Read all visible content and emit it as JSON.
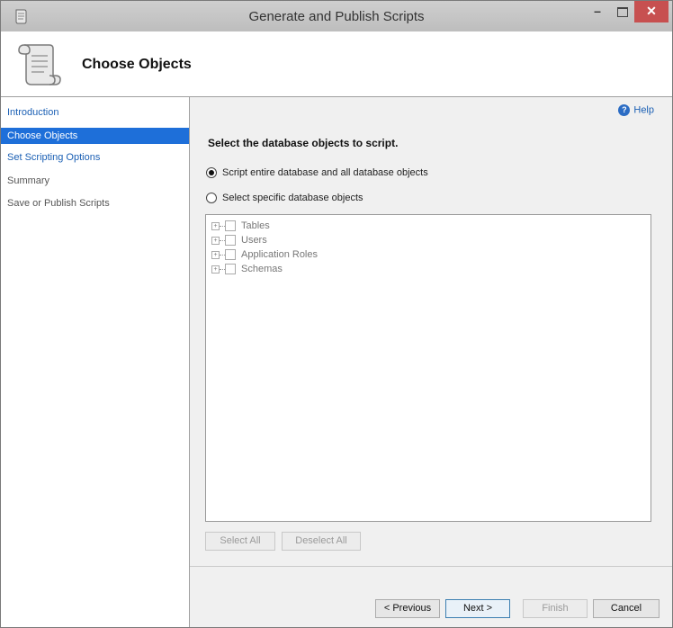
{
  "window": {
    "title": "Generate and Publish Scripts",
    "controls": {
      "minimize": "–",
      "close": "✕"
    }
  },
  "header": {
    "title": "Choose Objects",
    "icon": "scroll-icon"
  },
  "sidebar": {
    "items": [
      {
        "label": "Introduction",
        "state": "link"
      },
      {
        "label": "Choose Objects",
        "state": "active"
      },
      {
        "label": "Set Scripting Options",
        "state": "link"
      },
      {
        "label": "Summary",
        "state": "disabled"
      },
      {
        "label": "Save or Publish Scripts",
        "state": "disabled"
      }
    ]
  },
  "main": {
    "help_label": "Help",
    "help_icon": "?",
    "section_title": "Select the database objects to script.",
    "options": [
      {
        "label": "Script entire database and all database objects",
        "selected": true
      },
      {
        "label": "Select specific database objects",
        "selected": false
      }
    ],
    "tree": {
      "expander_symbol": "+",
      "items": [
        {
          "label": "Tables",
          "checked": false
        },
        {
          "label": "Users",
          "checked": false
        },
        {
          "label": "Application Roles",
          "checked": false
        },
        {
          "label": "Schemas",
          "checked": false
        }
      ]
    },
    "select_all_label": "Select All",
    "deselect_all_label": "Deselect All"
  },
  "footer": {
    "previous_label": "< Previous",
    "next_label": "Next >",
    "finish_label": "Finish",
    "cancel_label": "Cancel"
  },
  "colors": {
    "accent": "#1e6fd9",
    "link": "#1a5fb4",
    "close": "#c75050"
  }
}
